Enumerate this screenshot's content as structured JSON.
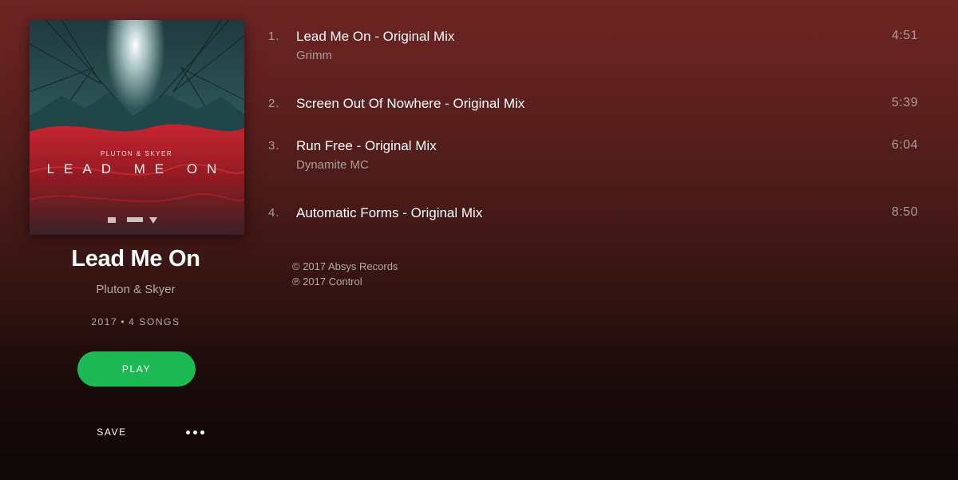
{
  "album": {
    "title": "Lead Me On",
    "artist": "Pluton & Skyer",
    "year": "2017",
    "song_count": "4 SONGS",
    "cover_text_artist": "PLUTON & SKYER",
    "cover_text_title": "LEAD ME ON"
  },
  "actions": {
    "play_label": "PLAY",
    "save_label": "SAVE",
    "more_icon": "more-dots-icon"
  },
  "tracks": [
    {
      "number": "1.",
      "title": "Lead Me On - Original Mix",
      "featuring": "Grimm",
      "duration": "4:51"
    },
    {
      "number": "2.",
      "title": "Screen Out Of Nowhere - Original Mix",
      "featuring": "",
      "duration": "5:39"
    },
    {
      "number": "3.",
      "title": "Run Free - Original Mix",
      "featuring": "Dynamite MC",
      "duration": "6:04"
    },
    {
      "number": "4.",
      "title": "Automatic Forms - Original Mix",
      "featuring": "",
      "duration": "8:50"
    }
  ],
  "copyright": {
    "c_line": "© 2017 Absys Records",
    "p_line": "℗ 2017 Control"
  },
  "colors": {
    "accent": "#1db954",
    "background_top": "#6e2523",
    "background_bottom": "#0d0707"
  }
}
